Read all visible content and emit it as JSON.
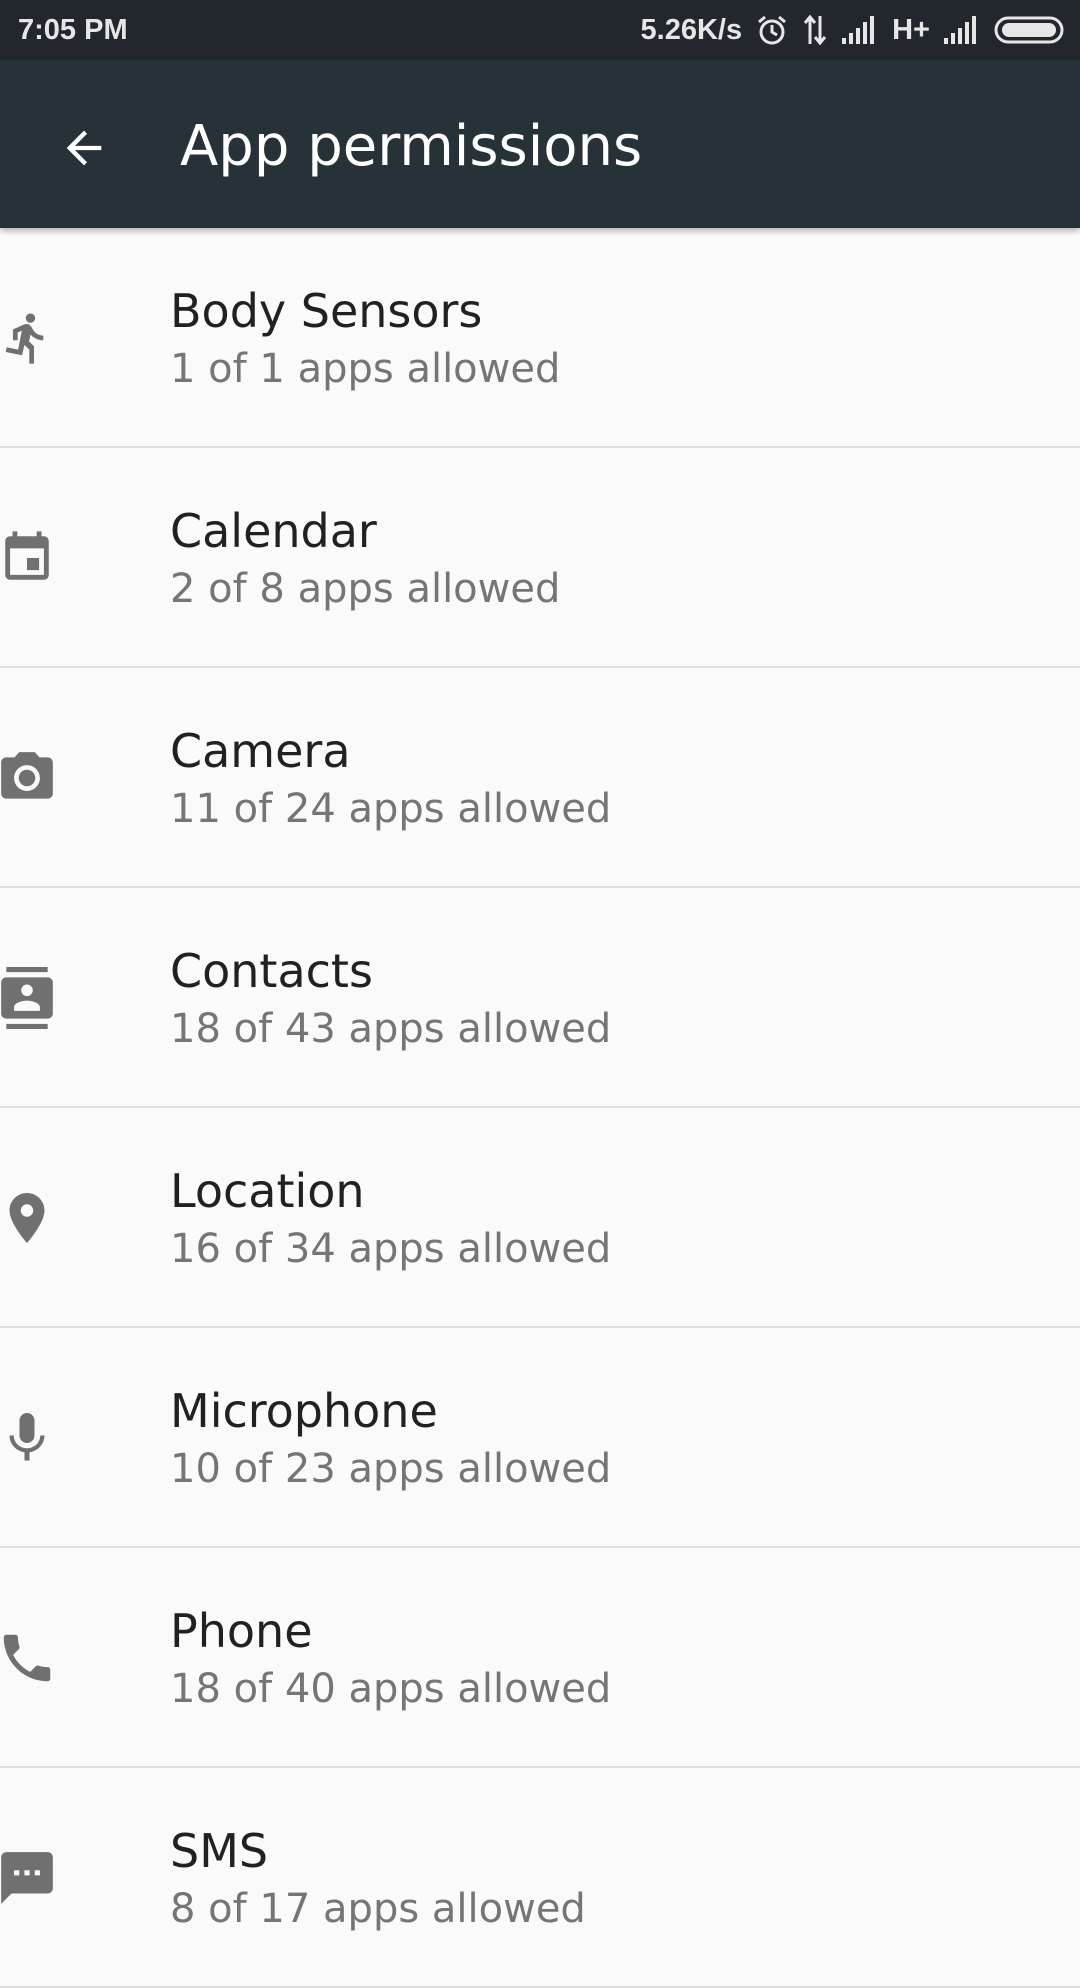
{
  "status_bar": {
    "time": "7:05 PM",
    "net_speed": "5.26K/s",
    "network_type": "H+",
    "icons": [
      "alarm-icon",
      "data-transfer-icon",
      "signal-icon",
      "signal-icon",
      "battery-icon"
    ]
  },
  "toolbar": {
    "title": "App permissions",
    "back_icon": "arrow-back-icon"
  },
  "permissions": [
    {
      "label": "Body Sensors",
      "summary": "1 of 1 apps allowed",
      "icon": "run-icon"
    },
    {
      "label": "Calendar",
      "summary": "2 of 8 apps allowed",
      "icon": "calendar-icon"
    },
    {
      "label": "Camera",
      "summary": "11 of 24 apps allowed",
      "icon": "camera-icon"
    },
    {
      "label": "Contacts",
      "summary": "18 of 43 apps allowed",
      "icon": "contacts-icon"
    },
    {
      "label": "Location",
      "summary": "16 of 34 apps allowed",
      "icon": "location-pin-icon"
    },
    {
      "label": "Microphone",
      "summary": "10 of 23 apps allowed",
      "icon": "microphone-icon"
    },
    {
      "label": "Phone",
      "summary": "18 of 40 apps allowed",
      "icon": "phone-icon"
    },
    {
      "label": "SMS",
      "summary": "8 of 17 apps allowed",
      "icon": "sms-icon"
    }
  ],
  "colors": {
    "status_bar": "#21272c",
    "toolbar": "#263238",
    "background": "#fafafa",
    "icon": "#707070",
    "title_text": "#212121",
    "summary_text": "#757575",
    "divider": "#dddddd"
  }
}
